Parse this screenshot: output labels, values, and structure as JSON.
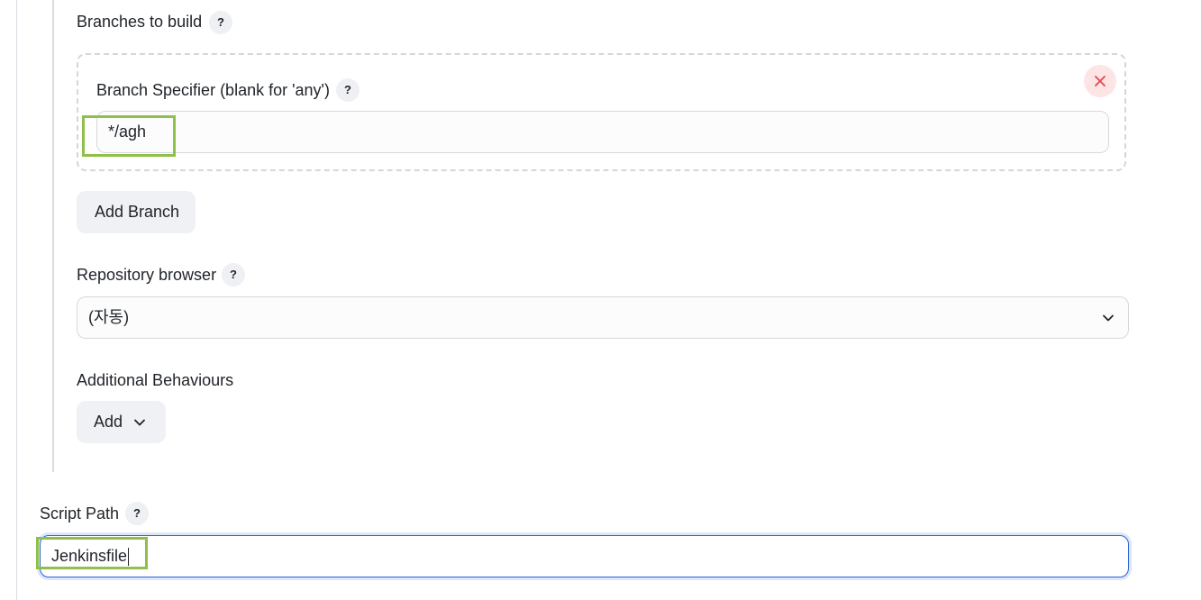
{
  "branches_section": {
    "label": "Branches to build",
    "help": "?"
  },
  "branch_spec": {
    "label": "Branch Specifier (blank for 'any')",
    "help": "?",
    "value": "*/agh",
    "close_icon": "close-icon"
  },
  "add_branch_label": "Add Branch",
  "repo_browser": {
    "label": "Repository browser",
    "help": "?",
    "selected": "(자동)",
    "chevron_icon": "chevron-down-icon"
  },
  "additional_behaviours": {
    "label": "Additional Behaviours",
    "add_label": "Add",
    "chevron_icon": "chevron-down-icon"
  },
  "script_path": {
    "label": "Script Path",
    "help": "?",
    "value": "Jenkinsfile"
  },
  "colors": {
    "highlight": "#8fc04a",
    "focus_border": "#2d63d4",
    "close_bg": "#fde4e5",
    "close_icon": "#e5484d"
  }
}
